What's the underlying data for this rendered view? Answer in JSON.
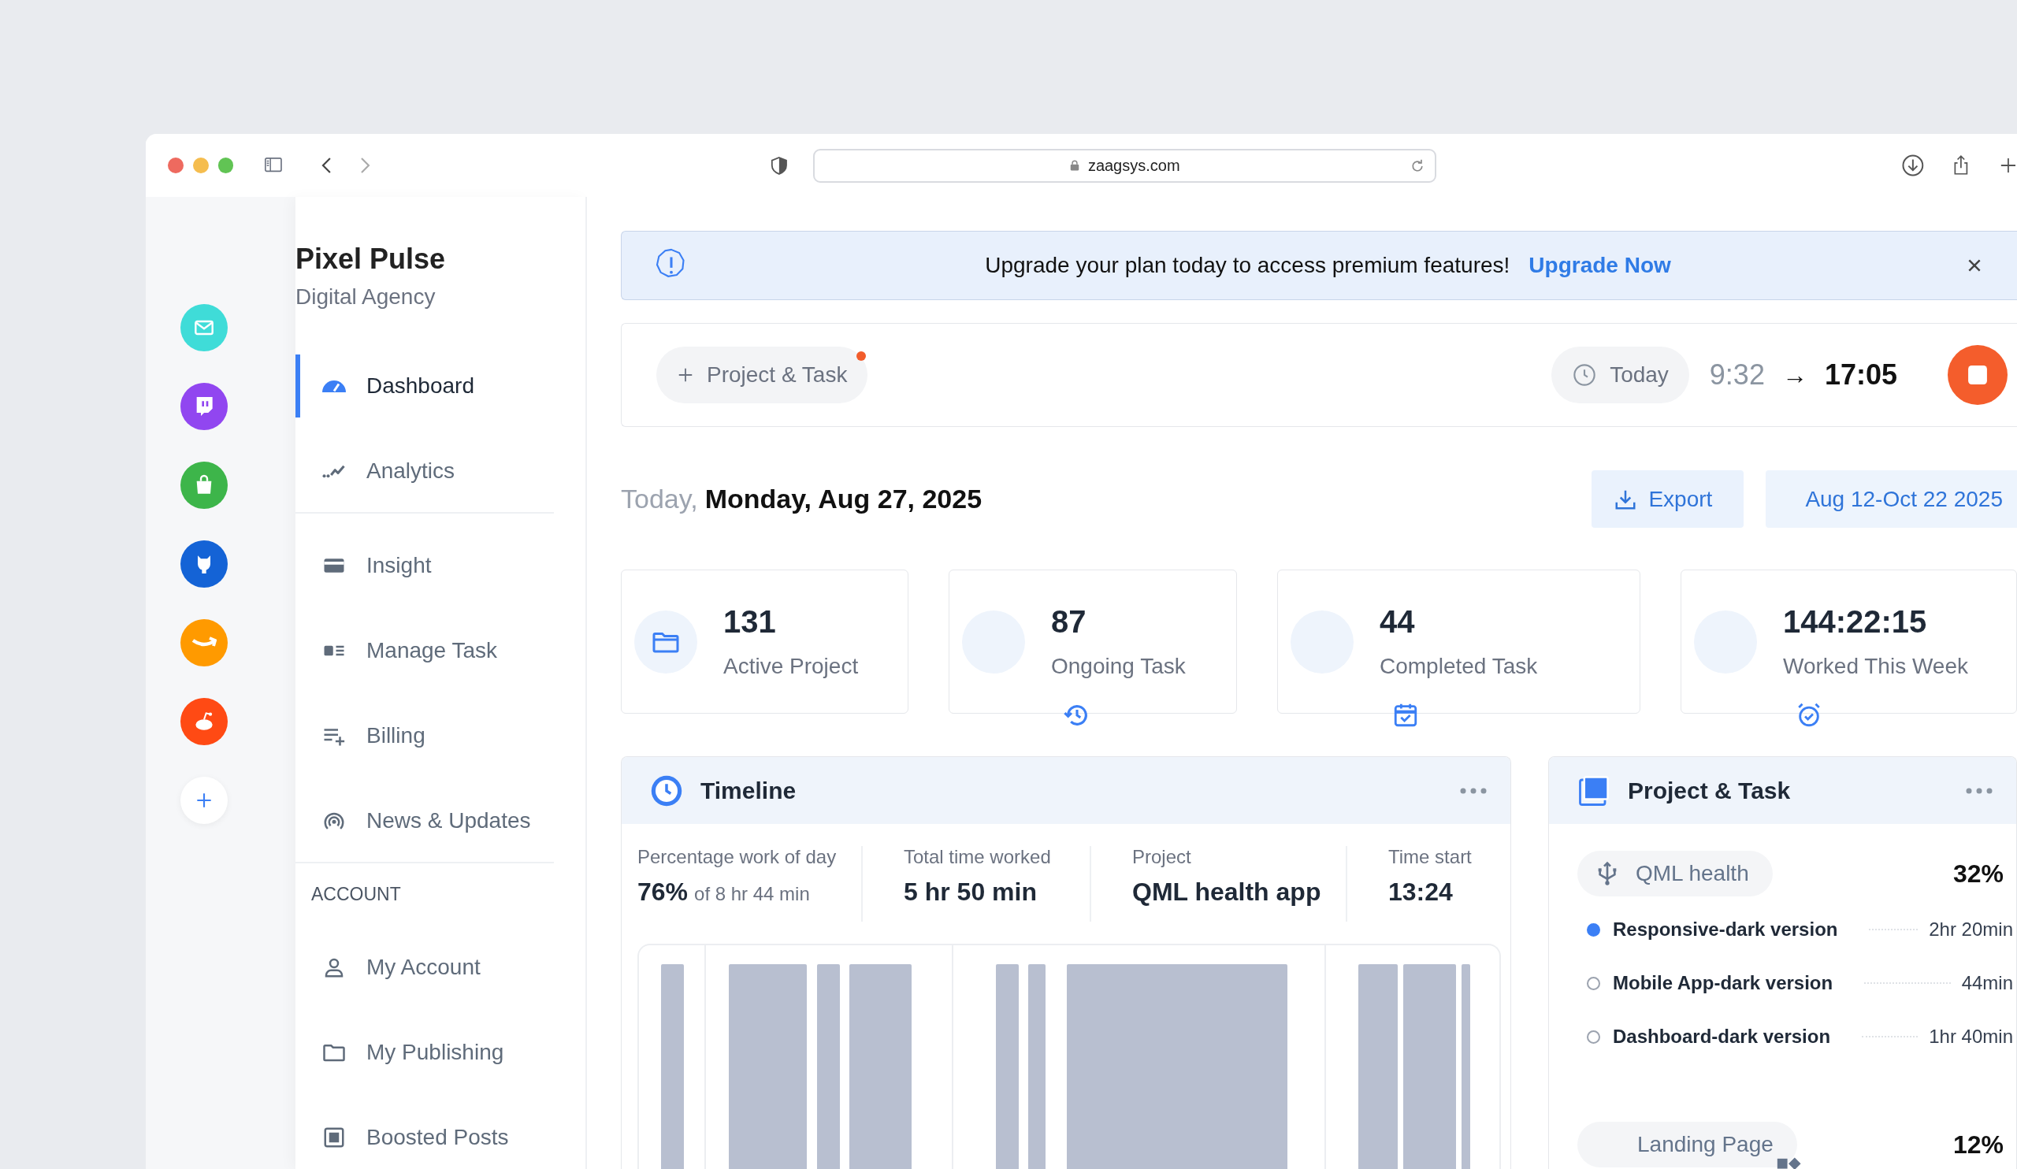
{
  "browser": {
    "url": "zaagsys.com"
  },
  "apps": [
    {
      "kind": "mail",
      "color": "#3fdcd8"
    },
    {
      "kind": "chat",
      "color": "#9146f0"
    },
    {
      "kind": "bag",
      "color": "#3db54a"
    },
    {
      "kind": "cat",
      "color": "#1463d6"
    },
    {
      "kind": "smile",
      "color": "#ff9a00"
    },
    {
      "kind": "antenna",
      "color": "#ff4a14"
    }
  ],
  "brand": {
    "name": "Pixel Pulse",
    "tagline": "Digital Agency"
  },
  "sidebar": {
    "groups": [
      {
        "items": [
          {
            "label": "Dashboard",
            "kind": "gauge",
            "selected": true
          },
          {
            "label": "Analytics",
            "kind": "trend",
            "selected": false
          }
        ]
      },
      {
        "items": [
          {
            "label": "Insight",
            "kind": "card",
            "selected": false
          },
          {
            "label": "Manage Task",
            "kind": "idcard",
            "selected": false
          },
          {
            "label": "Billing",
            "kind": "listplus",
            "selected": false
          },
          {
            "label": "News & Updates",
            "kind": "broadcast",
            "selected": false
          }
        ]
      },
      {
        "heading": "ACCOUNT",
        "items": [
          {
            "label": "My Account",
            "kind": "user",
            "selected": false
          },
          {
            "label": "My Publishing",
            "kind": "folder",
            "selected": false
          },
          {
            "label": "Boosted Posts",
            "kind": "frame",
            "selected": false
          }
        ]
      }
    ]
  },
  "banner": {
    "message": "Upgrade your plan today to access premium features!",
    "link": "Upgrade Now"
  },
  "timer": {
    "task_button": "Project & Task",
    "notification": true,
    "day": "Today",
    "start": "9:32",
    "arrow": "→",
    "end": "17:05",
    "running": true
  },
  "date_row": {
    "prefix": "Today,",
    "date": "Monday, Aug 27, 2025",
    "export": "Export",
    "range": "Aug 12-Oct 22 2025"
  },
  "stats": [
    {
      "value": "131",
      "label": "Active Project",
      "kind": "folder"
    },
    {
      "value": "87",
      "label": "Ongoing Task",
      "kind": "history"
    },
    {
      "value": "44",
      "label": "Completed Task",
      "kind": "calendar"
    },
    {
      "value": "144:22:15",
      "label": "Worked This Week",
      "kind": "alarm"
    }
  ],
  "timeline": {
    "title": "Timeline",
    "metrics": [
      {
        "label": "Percentage work of day",
        "value": "76%",
        "note": "of 8 hr 44 min"
      },
      {
        "label": "Total time worked",
        "value": "5 hr 50 min"
      },
      {
        "label": "Project",
        "value": "QML health app"
      },
      {
        "label": "Time start",
        "value": "13:24"
      }
    ]
  },
  "projects": {
    "title": "Project & Task",
    "groups": [
      {
        "name": "QML health",
        "kind": "usb",
        "percent": "32%",
        "tasks": [
          {
            "name": "Responsive-dark version",
            "time": "2hr 20min",
            "selected": true
          },
          {
            "name": "Mobile App-dark version",
            "time": "44min",
            "selected": false
          },
          {
            "name": "Dashboard-dark version",
            "time": "1hr 40min",
            "selected": false
          }
        ]
      },
      {
        "name": "Landing Page",
        "kind": "widgets",
        "percent": "12%"
      }
    ]
  }
}
